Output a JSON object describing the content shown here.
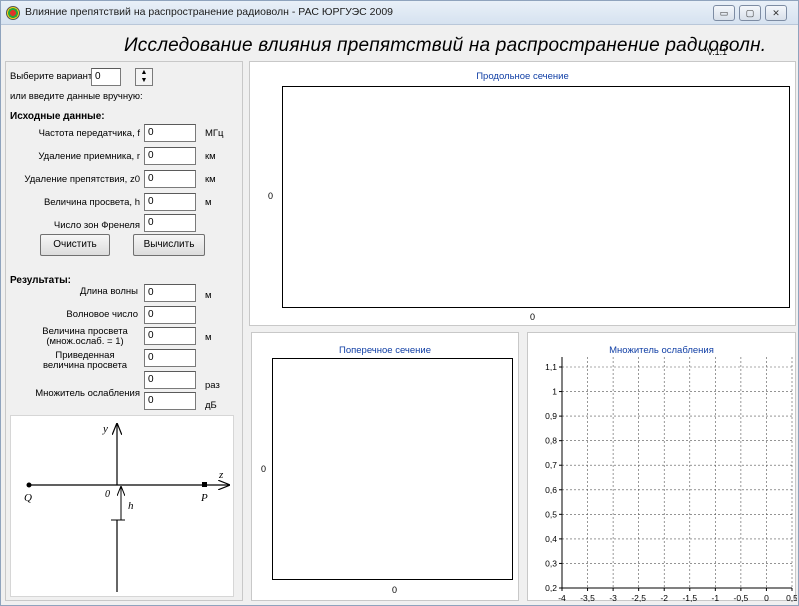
{
  "window": {
    "title": "Влияние препятствий на распространение радиоволн - РАС ЮРГУЭС 2009",
    "minimize_glyph": "▭",
    "maximize_glyph": "▢",
    "close_glyph": "✕"
  },
  "header": {
    "title": "Исследование влияния препятствий на распространение радиоволн.",
    "version": "V.1.1"
  },
  "variant": {
    "label": "Выберите вариант",
    "value": "0",
    "manual_hint": "или введите данные вручную:"
  },
  "inputs": {
    "section_title": "Исходные данные:",
    "fields": [
      {
        "label": "Частота передатчика, f",
        "value": "0",
        "unit": "МГц"
      },
      {
        "label": "Удаление приемника, r",
        "value": "0",
        "unit": "км"
      },
      {
        "label": "Удаление препятствия, z0",
        "value": "0",
        "unit": "км"
      },
      {
        "label": "Величина просвета, h",
        "value": "0",
        "unit": "м"
      },
      {
        "label": "Число зон Френеля",
        "value": "0",
        "unit": ""
      }
    ],
    "clear_button": "Очистить",
    "compute_button": "Вычислить"
  },
  "results": {
    "section_title": "Результаты:",
    "wavelength": {
      "label": "Длина волны",
      "value": "0",
      "unit": "м"
    },
    "wavenumber": {
      "label": "Волновое число",
      "value": "0"
    },
    "clearance_l1": "Величина просвета",
    "clearance_l2": "(множ.ослаб. = 1)",
    "clearance_value": "0",
    "clearance_unit": "м",
    "reduced_l1": "Приведенная",
    "reduced_l2": "величина просвета",
    "reduced_value": "0",
    "attenuation": {
      "label": "Множитель ослабления",
      "value_times": "0",
      "unit_times": "раз",
      "value_db": "0",
      "unit_db": "дБ"
    }
  },
  "diagram": {
    "y_label": "y",
    "z_label": "z",
    "origin_label": "0",
    "q_label": "Q",
    "p_label": "P",
    "h_label": "h"
  },
  "plots": {
    "longitudinal": {
      "title": "Продольное сечение",
      "y_tick": "0",
      "x_tick": "0"
    },
    "cross": {
      "title": "Поперечное сечение",
      "y_tick": "0",
      "x_tick": "0"
    }
  },
  "chart_data": {
    "type": "line",
    "title": "Множитель ослабления",
    "xlabel": "",
    "ylabel": "",
    "xlim": [
      -4,
      0.5
    ],
    "ylim": [
      0.2,
      1.1
    ],
    "x_ticks": [
      "-4",
      "-3,5",
      "-3",
      "-2,5",
      "-2",
      "-1,5",
      "-1",
      "-0,5",
      "0",
      "0,5"
    ],
    "y_ticks": [
      "0,2",
      "0,3",
      "0,4",
      "0,5",
      "0,6",
      "0,7",
      "0,8",
      "0,9",
      "1",
      "1,1"
    ],
    "grid": true,
    "series": []
  }
}
